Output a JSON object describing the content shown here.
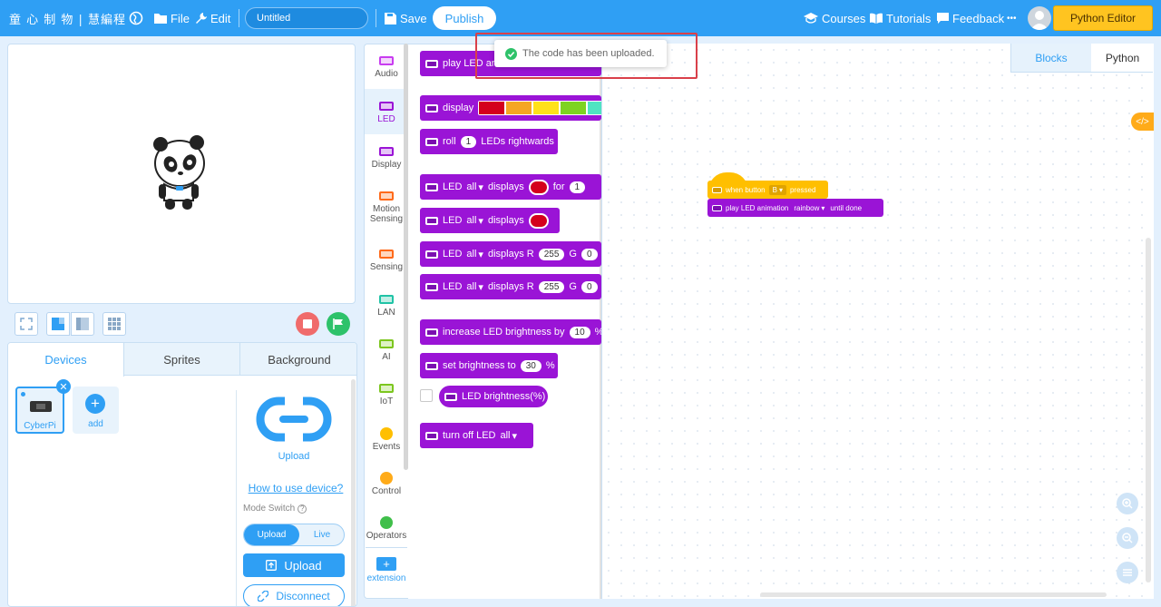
{
  "header": {
    "logo": "童 心 制 物 | 慧編程",
    "file_label": "File",
    "edit_label": "Edit",
    "project_title": "Untitled",
    "save_label": "Save",
    "publish_label": "Publish",
    "courses_label": "Courses",
    "tutorials_label": "Tutorials",
    "feedback_label": "Feedback",
    "more_label": "•••",
    "python_editor_label": "Python Editor"
  },
  "stage_controls": {
    "stop_color": "#f06b6b",
    "go_color": "#2ec26a"
  },
  "panel": {
    "tabs": [
      {
        "label": "Devices",
        "active": true
      },
      {
        "label": "Sprites",
        "active": false
      },
      {
        "label": "Background",
        "active": false
      }
    ],
    "device_name": "CyberPi",
    "add_label": "add",
    "upload_caption": "Upload",
    "how_to_link": "How to use device?",
    "mode_switch_label": "Mode Switch",
    "mode_upload": "Upload",
    "mode_live": "Live",
    "upload_button": "Upload",
    "disconnect_button": "Disconnect"
  },
  "categories": [
    {
      "label": "Audio",
      "color": "#c83cf0"
    },
    {
      "label": "LED",
      "color": "#9a14d6",
      "active": true
    },
    {
      "label": "Display",
      "color": "#9a14d6"
    },
    {
      "label": "Motion Sensing",
      "color": "#ff6a1a"
    },
    {
      "label": "Sensing",
      "color": "#ff6a1a"
    },
    {
      "label": "LAN",
      "color": "#20c3a6"
    },
    {
      "label": "AI",
      "color": "#7cc61e"
    },
    {
      "label": "IoT",
      "color": "#7cc61e"
    },
    {
      "label": "Events",
      "color": "#ffbf00"
    },
    {
      "label": "Control",
      "color": "#ffab19"
    },
    {
      "label": "Operators",
      "color": "#40bf4a"
    },
    {
      "label": "extension",
      "color": "#2f9ff4"
    }
  ],
  "palette": {
    "b1_text": "play LED ani",
    "b2_text": "display",
    "b2_colors": [
      "#d4001d",
      "#f5a623",
      "#ffe11a",
      "#7ed321",
      "#50e3c2"
    ],
    "b3_pre": "roll",
    "b3_val": "1",
    "b3_post": "LEDs rightwards",
    "b4_led": "LED",
    "b4_all": "all",
    "b4_mid": "displays",
    "b4_for": "for",
    "b4_val": "1",
    "b5_led": "LED",
    "b5_all": "all",
    "b5_mid": "displays",
    "b6_led": "LED",
    "b6_all": "all",
    "b6_mid": "displays R",
    "b6_r": "255",
    "b6_g": "G",
    "b6_gv": "0",
    "b7_led": "LED",
    "b7_all": "all",
    "b7_mid": "displays R",
    "b7_r": "255",
    "b7_g": "G",
    "b7_gv": "0",
    "b8_pre": "increase LED brightness by",
    "b8_val": "10",
    "b8_post": "%",
    "b9_pre": "set brightness to",
    "b9_val": "30",
    "b9_post": "%",
    "b10_text": "LED brightness(%)",
    "b11_pre": "turn off LED",
    "b11_all": "all",
    "led_red": "#d4001d"
  },
  "code_tabs": {
    "blocks": "Blocks",
    "python": "Python"
  },
  "script": {
    "hat_pre": "when button",
    "hat_val": "B",
    "hat_post": "pressed",
    "cmd_pre": "play LED animation",
    "cmd_val": "rainbow",
    "cmd_post": "until done"
  },
  "toast": {
    "message": "The code has been uploaded."
  }
}
